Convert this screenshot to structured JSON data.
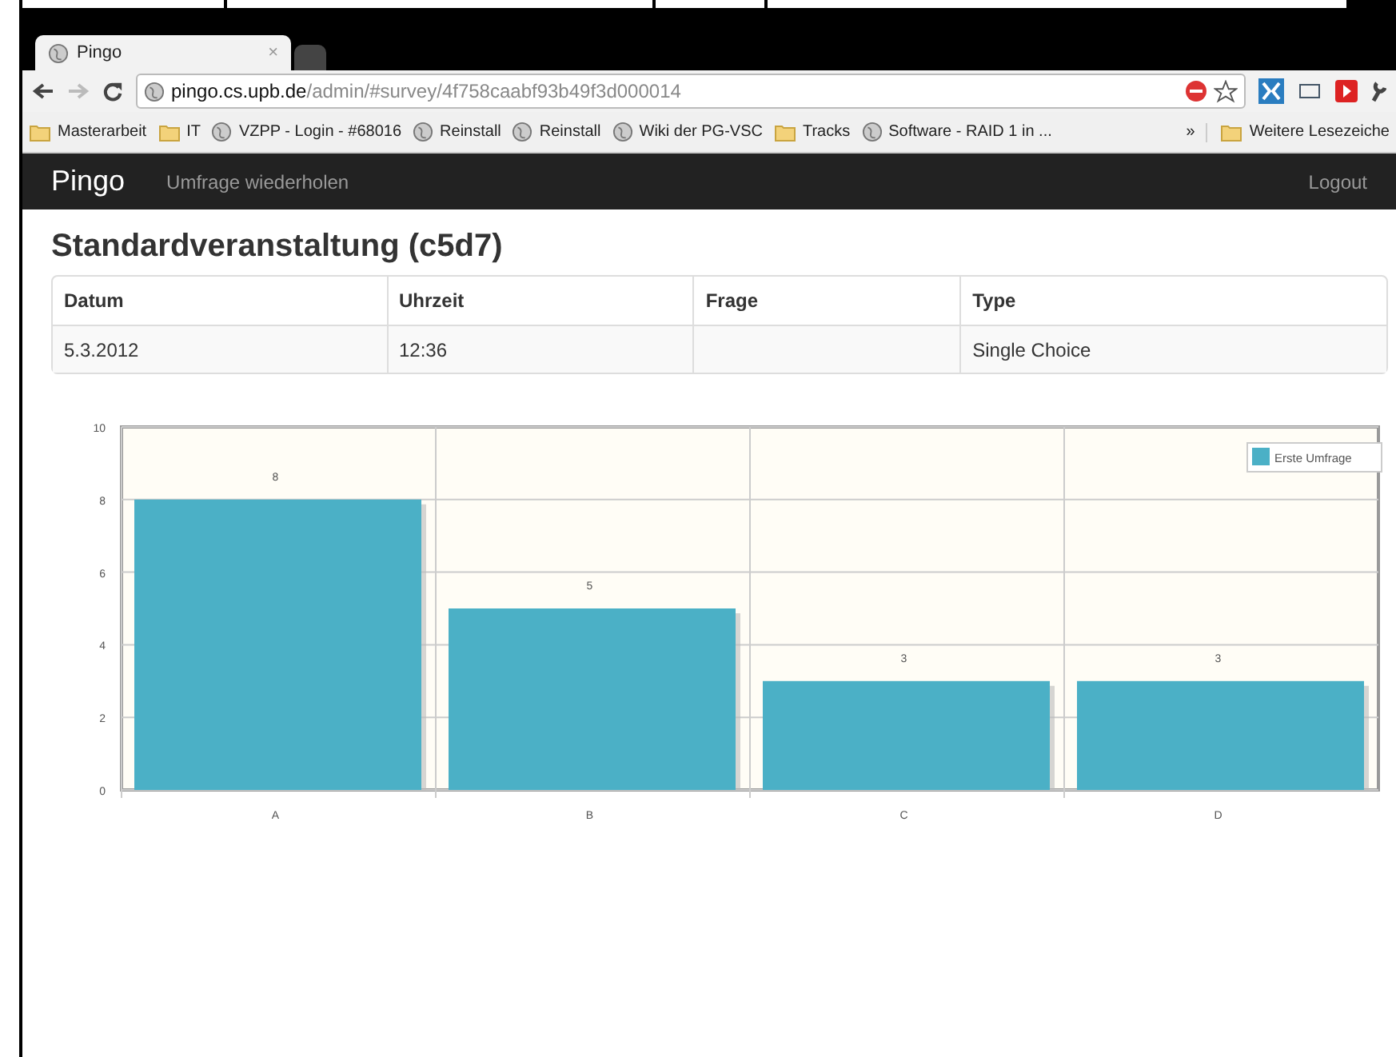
{
  "browser": {
    "tabs": [
      {
        "title": "Pingo",
        "close": "×",
        "selected": true
      },
      {
        "selected": false
      }
    ],
    "url_host": "pingo.cs.upb.de",
    "url_path": "/admin/#survey/4f758caabf93b49f3d000014",
    "bookmarks": [
      {
        "kind": "folder",
        "label": "Masterarbeit"
      },
      {
        "kind": "folder",
        "label": "IT"
      },
      {
        "kind": "page",
        "label": "VZPP - Login - #68016"
      },
      {
        "kind": "page",
        "label": "Reinstall"
      },
      {
        "kind": "page",
        "label": "Reinstall"
      },
      {
        "kind": "page",
        "label": "Wiki der PG-VSC"
      },
      {
        "kind": "folder",
        "label": "Tracks"
      },
      {
        "kind": "page",
        "label": "Software - RAID 1 in ..."
      }
    ],
    "more": "»",
    "other_bookmarks": "Weitere Lesezeiche"
  },
  "navbar": {
    "brand": "Pingo",
    "links": [
      "Umfrage wiederholen"
    ],
    "right_link": "Logout"
  },
  "page": {
    "title": "Standardveranstaltung (c5d7)",
    "table": {
      "columns": [
        "Datum",
        "Uhrzeit",
        "Frage",
        "Type"
      ],
      "rows": [
        [
          "5.3.2012",
          "12:36",
          "",
          "Single Choice"
        ]
      ]
    },
    "chart_data": {
      "type": "bar",
      "categories": [
        "A",
        "B",
        "C",
        "D"
      ],
      "series": [
        {
          "name": "Erste Umfrage",
          "color": "#4bb0c6",
          "values": [
            8,
            5,
            3,
            3
          ]
        }
      ],
      "ylim": [
        0,
        10
      ],
      "grid": true,
      "yticks": [
        0,
        2,
        4,
        6,
        8,
        10
      ],
      "data_labels": true
    }
  }
}
